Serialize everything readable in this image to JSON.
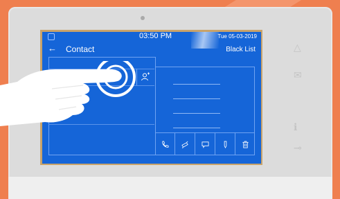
{
  "status": {
    "time": "03:50 PM",
    "date": "Tue  05-03-2019"
  },
  "header": {
    "back_icon": "back-arrow-icon",
    "title": "Contact",
    "black_list_label": "Black List"
  },
  "actions": [
    {
      "name": "call-icon",
      "glyph": "phone"
    },
    {
      "name": "monitor-icon",
      "glyph": "camera"
    },
    {
      "name": "message-icon",
      "glyph": "chat"
    },
    {
      "name": "edit-icon",
      "glyph": "pen"
    },
    {
      "name": "delete-icon",
      "glyph": "trash"
    }
  ],
  "colors": {
    "screen_bg": "#1565d8",
    "background": "#ef7f4f",
    "device": "#dcdcdc"
  }
}
